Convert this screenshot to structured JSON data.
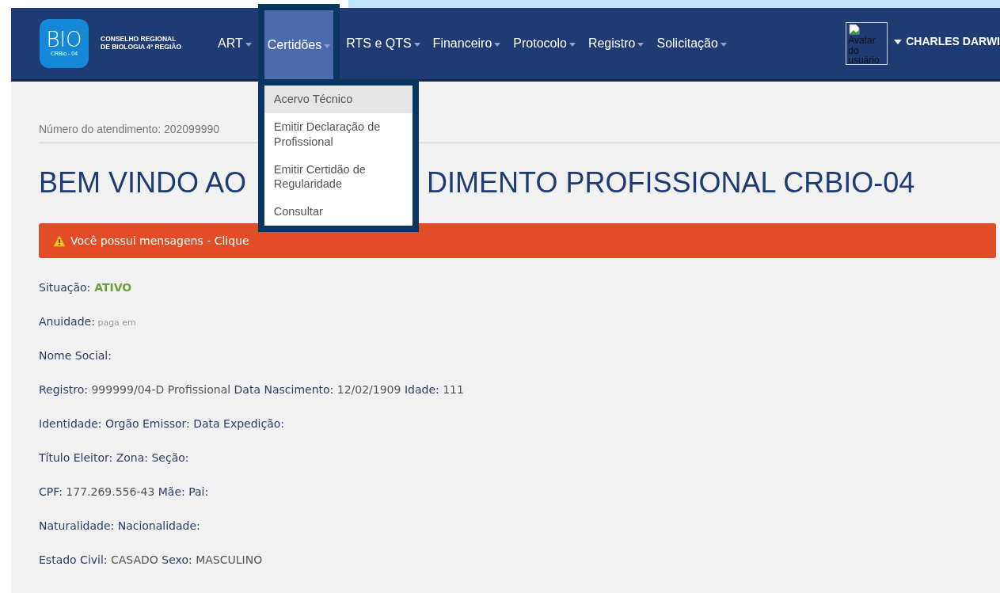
{
  "logo": {
    "mark": "BIO",
    "sub": "CRBio - 04",
    "line1": "CONSELHO REGIONAL",
    "line2": "DE BIOLOGIA 4ª REGIÃO"
  },
  "nav": [
    {
      "label": "ART",
      "selected": false
    },
    {
      "label": "Certidões",
      "selected": true
    },
    {
      "label": "RTS e QTS",
      "selected": false
    },
    {
      "label": "Financeiro",
      "selected": false
    },
    {
      "label": "Protocolo",
      "selected": false
    },
    {
      "label": "Registro",
      "selected": false
    },
    {
      "label": "Solicitação",
      "selected": false
    }
  ],
  "dropdown": [
    {
      "label": "Acervo Técnico",
      "selected": true
    },
    {
      "label": "Emitir Declaração de Profissional",
      "selected": false
    },
    {
      "label": "Emitir Certidão de Regularidade",
      "selected": false
    },
    {
      "label": "Consultar",
      "selected": false
    }
  ],
  "user": {
    "avatar_alt": "Avatar do usuário",
    "name": "CHARLES DARWI"
  },
  "attendance": "Número do atendimento: 202099990",
  "heading": {
    "left": "BEM VINDO AO",
    "right": "DIMENTO PROFISSIONAL CRBIO-04"
  },
  "alert": "Você possui mensagens - Clique",
  "info": [
    [
      {
        "kind": "label",
        "text": "Situação:"
      },
      {
        "kind": "status",
        "text": "ATIVO"
      }
    ],
    [
      {
        "kind": "label",
        "text": "Anuidade:"
      },
      {
        "kind": "note",
        "text": "paga em"
      }
    ],
    [
      {
        "kind": "label",
        "text": "Nome Social:"
      }
    ],
    [
      {
        "kind": "label",
        "text": "Registro:"
      },
      {
        "kind": "value",
        "text": "999999/04-D Profissional"
      },
      {
        "kind": "label",
        "text": "Data Nascimento:"
      },
      {
        "kind": "value",
        "text": "12/02/1909"
      },
      {
        "kind": "label",
        "text": " Idade:"
      },
      {
        "kind": "value",
        "text": "111"
      }
    ],
    [
      {
        "kind": "label",
        "text": "Identidade: Orgão Emissor: Data Expedição:"
      }
    ],
    [
      {
        "kind": "label",
        "text": "Título Eleitor: Zona: Seção:"
      }
    ],
    [
      {
        "kind": "label",
        "text": "CPF:"
      },
      {
        "kind": "value",
        "text": "177.269.556-43"
      },
      {
        "kind": "label",
        "text": "Mãe: Pai:"
      }
    ],
    [
      {
        "kind": "label",
        "text": "Naturalidade: Nacionalidade:"
      }
    ],
    [
      {
        "kind": "label",
        "text": "Estado Civil:"
      },
      {
        "kind": "value",
        "text": "CASADO"
      },
      {
        "kind": "label",
        "text": "Sexo:"
      },
      {
        "kind": "value",
        "text": "MASCULINO"
      }
    ]
  ]
}
